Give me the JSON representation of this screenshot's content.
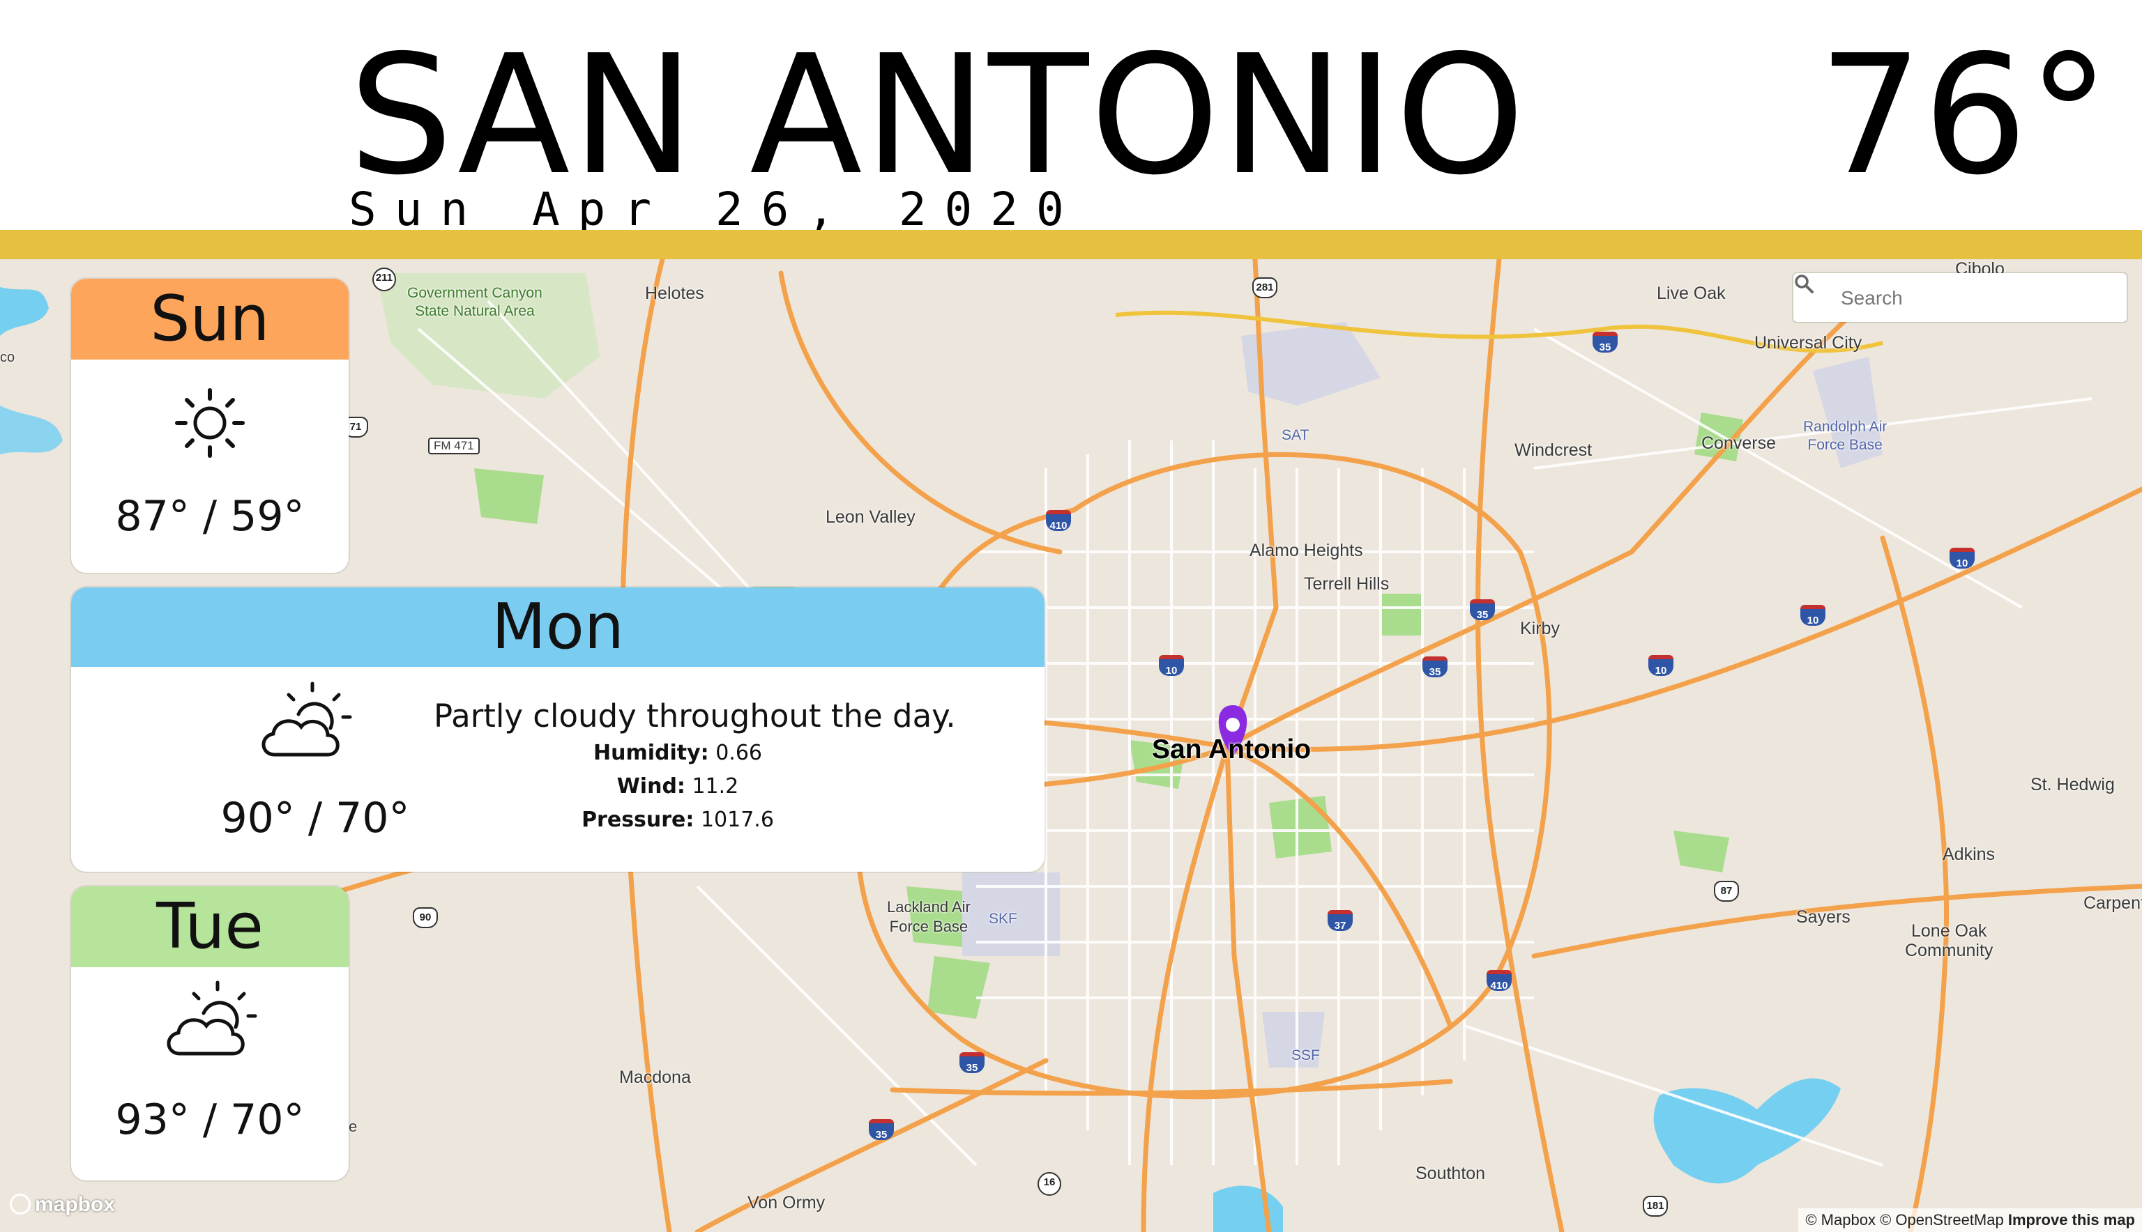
{
  "header": {
    "city": "SAN ANTONIO",
    "date": "Sun Apr 26, 2020",
    "temperature": "76°",
    "accent_color": "#e6c040"
  },
  "search": {
    "placeholder": "Search"
  },
  "forecast": [
    {
      "day": "Sun",
      "icon": "sunny-icon",
      "temps": "87° / 59°",
      "color": "#fca55b"
    },
    {
      "day": "Mon",
      "icon": "partly-cloudy-icon",
      "temps": "90° / 70°",
      "color": "#7acdf0",
      "summary": "Partly cloudy throughout the day.",
      "humidity_label": "Humidity:",
      "humidity": "0.66",
      "wind_label": "Wind:",
      "wind": "11.2",
      "pressure_label": "Pressure:",
      "pressure": "1017.6"
    },
    {
      "day": "Tue",
      "icon": "partly-cloudy-icon",
      "temps": "93° / 70°",
      "color": "#b5e49a"
    }
  ],
  "map": {
    "center_label": "San Antonio",
    "places": {
      "helotes": "Helotes",
      "live_oak": "Live Oak",
      "universal_city": "Universal City",
      "cibolo": "Cibolo",
      "windcrest": "Windcrest",
      "converse": "Converse",
      "randolph_1": "Randolph Air",
      "randolph_2": "Force Base",
      "leon_valley": "Leon Valley",
      "alamo_heights": "Alamo Heights",
      "terrell_hills": "Terrell Hills",
      "kirby": "Kirby",
      "st_hedwig": "St. Hedwig",
      "adkins": "Adkins",
      "sayers": "Sayers",
      "lone_oak_1": "Lone Oak",
      "lone_oak_2": "Community",
      "carpenter": "Carpent",
      "lackland_1": "Lackland Air",
      "lackland_2": "Force Base",
      "macdona": "Macdona",
      "southton": "Southton",
      "von_ormy": "Von Ormy",
      "gov_canyon_1": "Government Canyon",
      "gov_canyon_2": "State Natural Area",
      "sat": "SAT",
      "skf": "SKF",
      "ssf": "SSF",
      "fm471": "FM 471",
      "co": "co",
      "e": "e"
    },
    "shields": {
      "s211": "211",
      "s281": "281",
      "s35a": "35",
      "s71": "71",
      "s410a": "410",
      "s10a": "10",
      "s35b": "35",
      "s35c": "35",
      "s10b": "10",
      "s10c": "10",
      "s10d": "10",
      "s90": "90",
      "s37": "37",
      "s87": "87",
      "s410b": "410",
      "s35d": "35",
      "s35e": "35",
      "s16": "16",
      "s181": "181"
    },
    "logo": "mapbox",
    "attribution": {
      "mapbox": "© Mapbox",
      "osm": "© OpenStreetMap",
      "improve": "Improve this map"
    }
  }
}
